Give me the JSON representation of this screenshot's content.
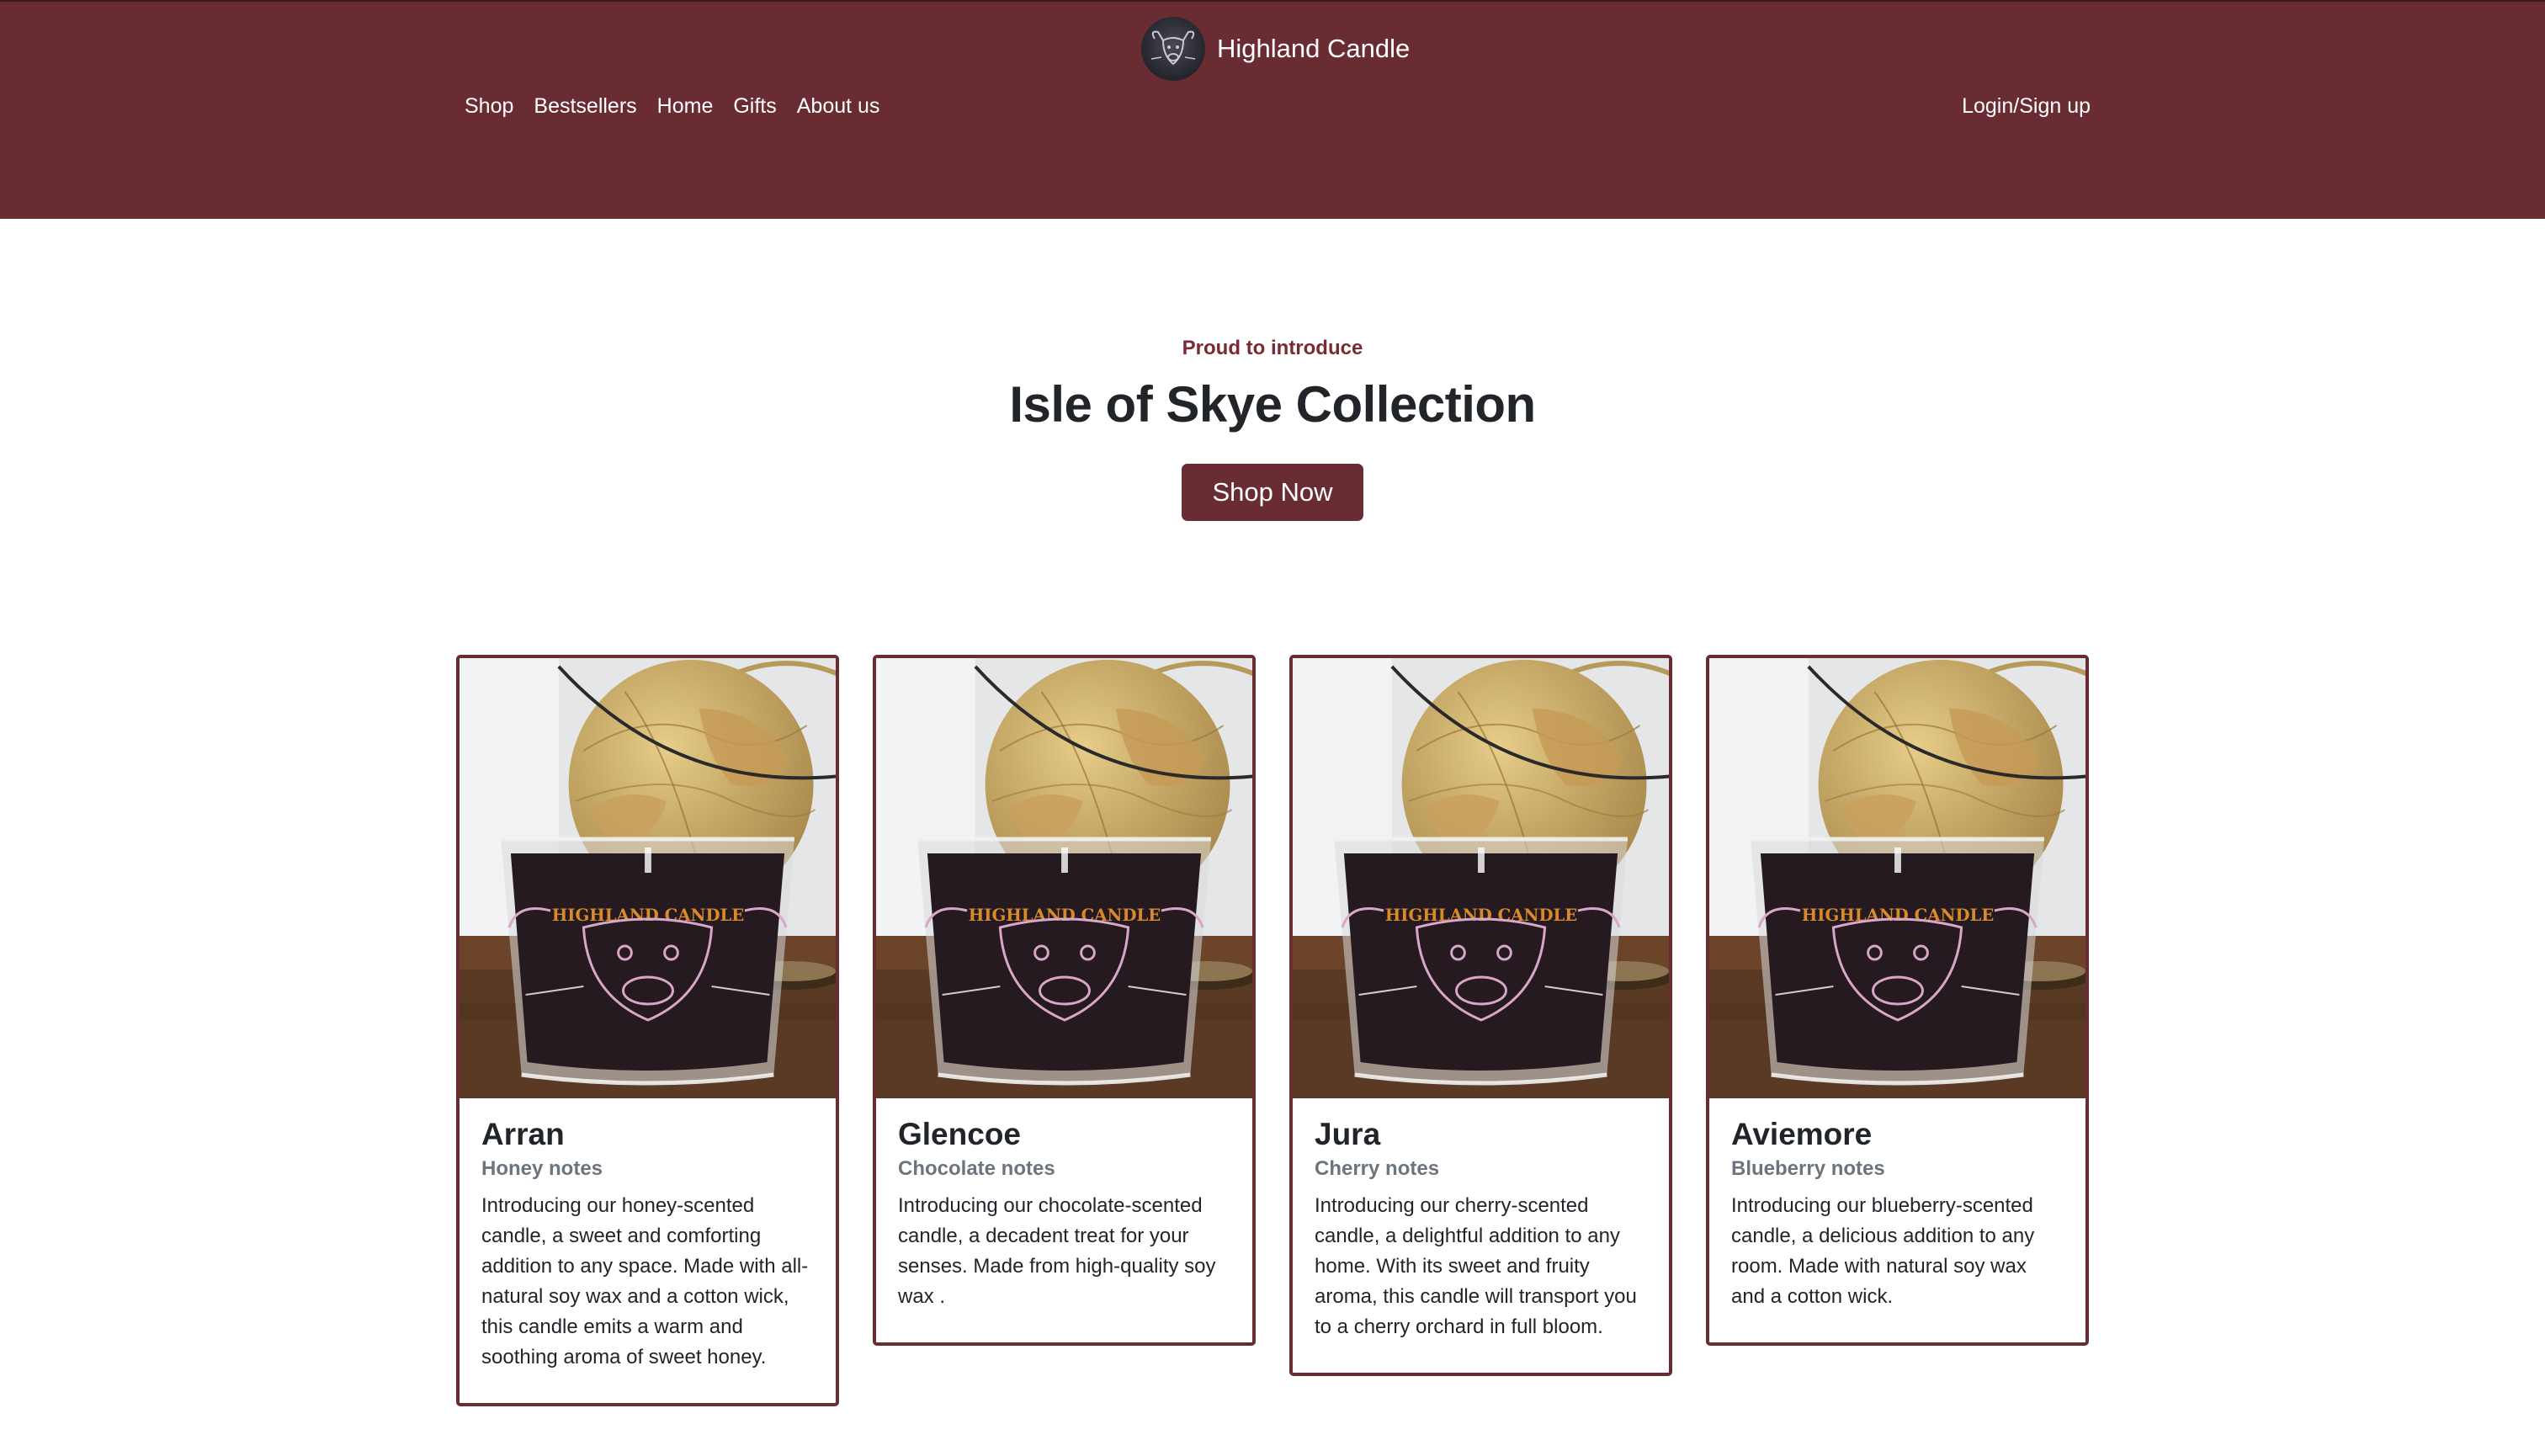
{
  "brand": {
    "name": "Highland Candle",
    "logo_icon": "highland-cow-icon"
  },
  "nav": {
    "links": [
      "Shop",
      "Bestsellers",
      "Home",
      "Gifts",
      "About us"
    ],
    "login": "Login/Sign up"
  },
  "hero": {
    "eyebrow": "Proud to introduce",
    "title": "Isle of Skye Collection",
    "cta": "Shop Now"
  },
  "products": [
    {
      "name": "Arran",
      "notes": "Honey notes",
      "description": "Introducing our honey-scented candle, a sweet and comforting addition to any space. Made with all-natural soy wax and a cotton wick, this candle emits a warm and soothing aroma of sweet honey."
    },
    {
      "name": "Glencoe",
      "notes": "Chocolate notes",
      "description": "Introducing our chocolate-scented candle, a decadent treat for your senses. Made from high-quality soy wax ."
    },
    {
      "name": "Jura",
      "notes": "Cherry notes",
      "description": "Introducing our cherry-scented candle, a delightful addition to any home. With its sweet and fruity aroma, this candle will transport you to a cherry orchard in full bloom."
    },
    {
      "name": "Aviemore",
      "notes": "Blueberry notes",
      "description": "Introducing our blueberry-scented candle, a delicious addition to any room. Made with natural soy wax and a cotton wick."
    }
  ],
  "product_label_text": "HIGHLAND CANDLE",
  "colors": {
    "brand": "#6a2c33",
    "accent": "#7a2a33",
    "muted": "#6c757d"
  }
}
